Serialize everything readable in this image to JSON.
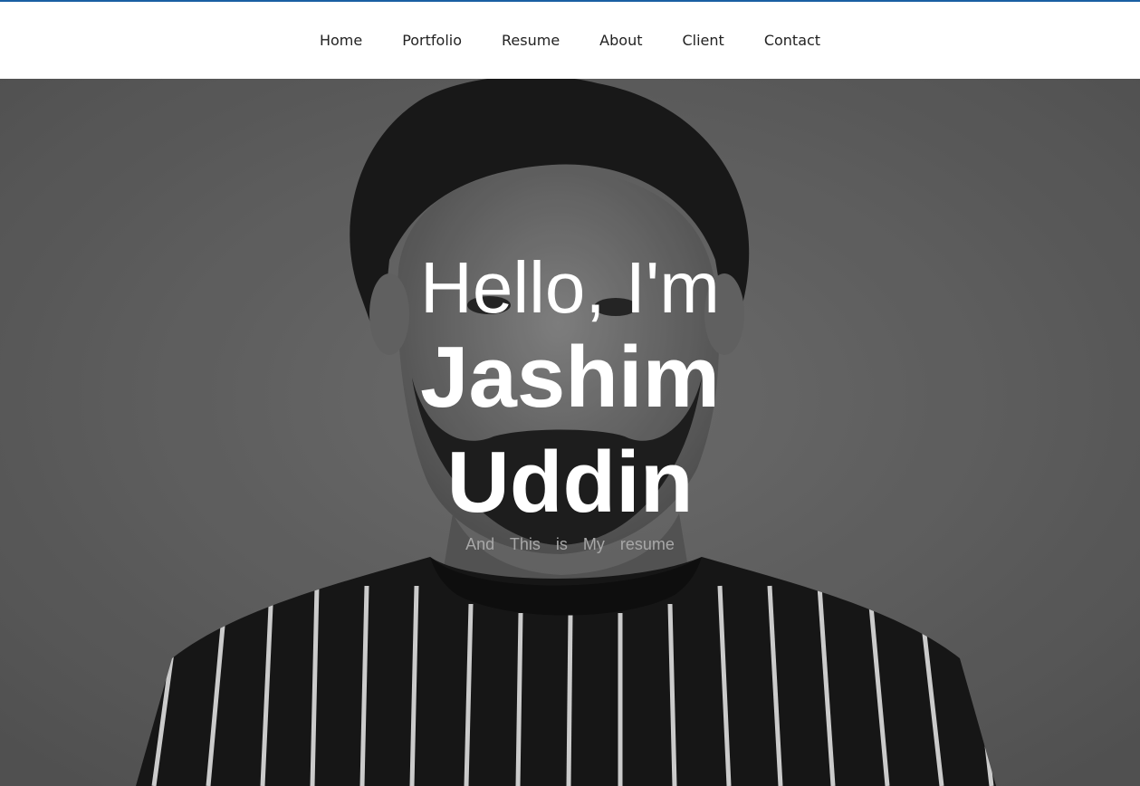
{
  "nav": {
    "items": [
      {
        "label": "Home"
      },
      {
        "label": "Portfolio"
      },
      {
        "label": "Resume"
      },
      {
        "label": "About"
      },
      {
        "label": "Client"
      },
      {
        "label": "Contact"
      }
    ]
  },
  "hero": {
    "greeting": "Hello, I'm",
    "first_name": "Jashim",
    "last_name": "Uddin",
    "tagline": "And This is My resume"
  },
  "colors": {
    "accent_line": "#1a5fa3",
    "nav_background": "#ffffff",
    "hero_text": "#ffffff",
    "tagline_text": "#a8a8a8"
  },
  "icons": {
    "background_image": "portrait-photo"
  }
}
